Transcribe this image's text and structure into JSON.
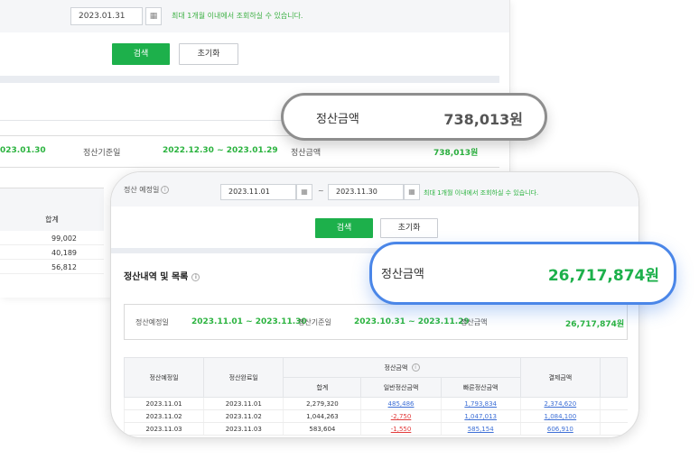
{
  "back": {
    "date_value": "2023.01.31",
    "note": "최대 1개월 이내에서 조회하실 수 있습니다.",
    "search_label": "검색",
    "reset_label": "초기화",
    "summary": {
      "date_fragment": "023.01.30",
      "base_label": "정산기준일",
      "base_range": "2022.12.30 ~ 2023.01.29",
      "amount_label": "정산금액",
      "amount_value": "738,013원"
    },
    "table": {
      "header": "합계",
      "values": [
        "99,002",
        "40,189",
        "56,812"
      ]
    },
    "callout": {
      "label": "정산금액",
      "value": "738,013원"
    }
  },
  "front": {
    "label": "정산 예정일",
    "date_from": "2023.11.01",
    "date_to": "2023.11.30",
    "tilde": "~",
    "note": "최대 1개월 이내에서 조회하실 수 있습니다.",
    "search_label": "검색",
    "reset_label": "초기화",
    "section_title": "정산내역 및 목록",
    "summary": {
      "scheduled_label": "정산예정일",
      "scheduled_range": "2023.11.01 ~ 2023.11.30",
      "base_label": "정산기준일",
      "base_range": "2023.10.31 ~ 2023.11.29",
      "amount_label": "정산금액",
      "amount_value": "26,717,874원"
    },
    "table": {
      "col_scheduled": "정산예정일",
      "col_completed": "정산완료일",
      "group_header": "정산금액",
      "col_total": "합계",
      "col_general": "일반정산금액",
      "col_fast": "빠른정산금액",
      "col_payment": "결제금액",
      "rows": [
        {
          "scheduled": "2023.11.01",
          "completed": "2023.11.01",
          "total": "2,279,320",
          "general": "485,486",
          "fast": "1,793,834",
          "payment": "2,374,620"
        },
        {
          "scheduled": "2023.11.02",
          "completed": "2023.11.02",
          "total": "1,044,263",
          "general": "-2,750",
          "fast": "1,047,013",
          "payment": "1,084,100"
        },
        {
          "scheduled": "2023.11.03",
          "completed": "2023.11.03",
          "total": "583,604",
          "general": "-1,550",
          "fast": "585,154",
          "payment": "606,910"
        }
      ]
    },
    "callout": {
      "label": "정산금액",
      "value": "26,717,874원"
    }
  },
  "colors": {
    "accent_green": "#1db04b",
    "callout_blue": "#4a86e8",
    "callout_gray": "#8e8e8e",
    "negative_red": "#e23b3b",
    "link_blue": "#3d6fd6"
  }
}
